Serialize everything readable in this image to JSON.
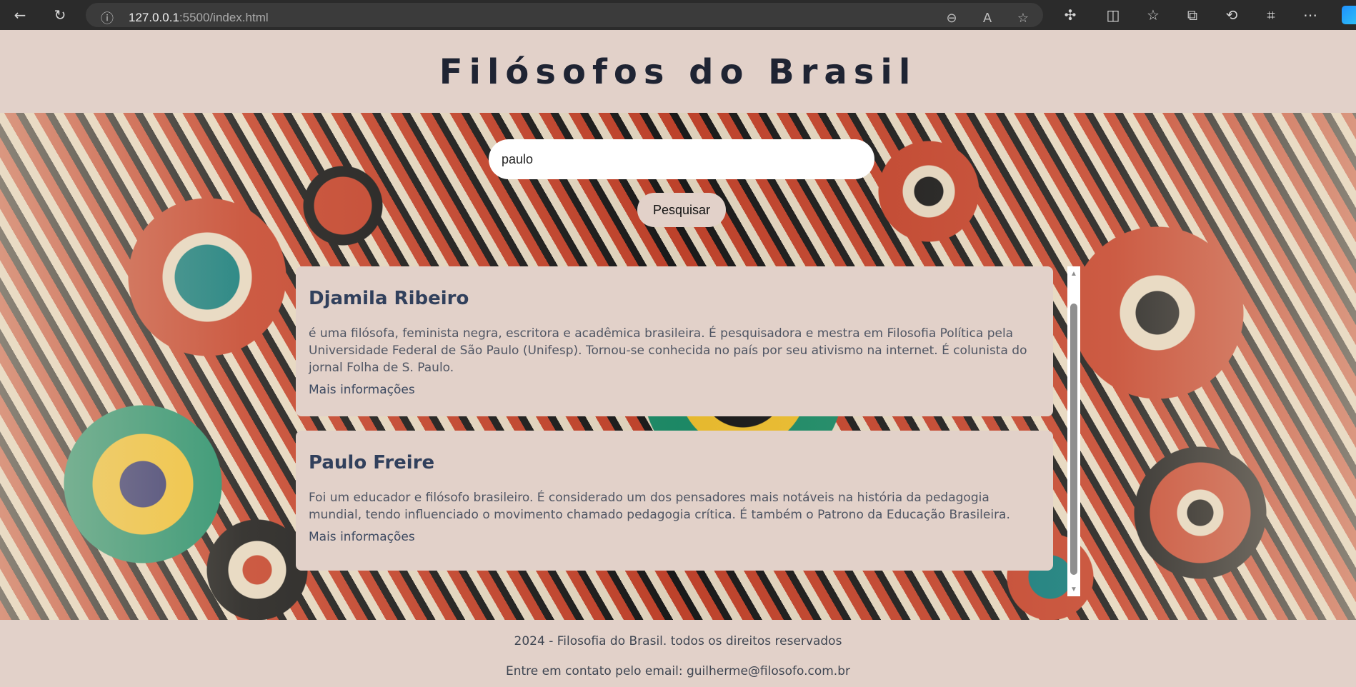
{
  "browser": {
    "url_host": "127.0.0.1",
    "url_path": ":5500/index.html"
  },
  "header": {
    "title": "Filósofos do Brasil"
  },
  "search": {
    "value": "paulo",
    "button_label": "Pesquisar"
  },
  "results": [
    {
      "name": "Djamila Ribeiro",
      "description": "é uma filósofa, feminista negra, escritora e acadêmica brasileira. É pesquisadora e mestra em Filosofia Política pela Universidade Federal de São Paulo (Unifesp). Tornou-se conhecida no país por seu ativismo na internet. É colunista do jornal Folha de S. Paulo.",
      "link": "Mais informações"
    },
    {
      "name": "Paulo Freire",
      "description": "Foi um educador e filósofo brasileiro. É considerado um dos pensadores mais notáveis na história da pedagogia mundial, tendo influenciado o movimento chamado pedagogia crítica. É também o Patrono da Educação Brasileira.",
      "link": "Mais informações"
    }
  ],
  "footer": {
    "copyright": "2024 - Filosofia do Brasil. todos os direitos reservados",
    "contact": "Entre em contato pelo email: guilherme@filosofo.com.br"
  },
  "colors": {
    "background": "#e2d1c9",
    "title": "#1f2433",
    "card_heading": "#31405c"
  }
}
